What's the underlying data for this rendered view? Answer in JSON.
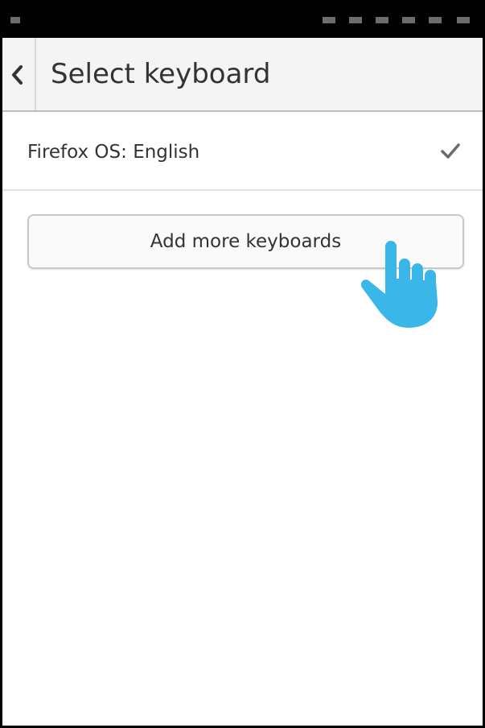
{
  "header": {
    "title": "Select keyboard",
    "back_icon": "chevron-left-icon"
  },
  "keyboards": [
    {
      "label": "Firefox OS: English",
      "selected": true,
      "status_icon": "checkmark-icon"
    }
  ],
  "actions": {
    "add_more_label": "Add more keyboards"
  },
  "overlay": {
    "pointer_icon": "tap-hand-icon",
    "pointer_color": "#3ab7e8"
  },
  "colors": {
    "status_bar": "#000000",
    "header_bg": "#f4f4f4",
    "text": "#333333"
  }
}
